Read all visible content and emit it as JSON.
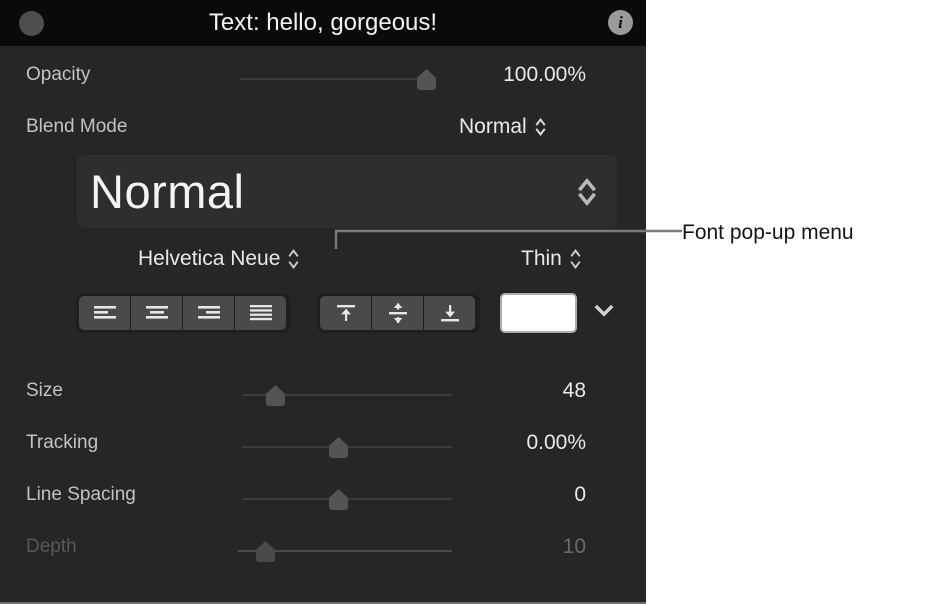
{
  "window": {
    "title": "Text: hello, gorgeous!",
    "left_circle_icon": "circle-icon",
    "info_icon": "i"
  },
  "inspector": {
    "opacity": {
      "label": "Opacity",
      "value": "100.00%",
      "slider": {
        "percent": 100
      }
    },
    "blend_mode": {
      "label": "Blend Mode",
      "value": "Normal"
    },
    "font_preview": {
      "value": "Normal",
      "chevron_icon": "chevron-up-down-icon"
    },
    "font_family": {
      "value": "Helvetica Neue",
      "chevron_icon": "chevron-up-down-icon"
    },
    "font_weight": {
      "value": "Thin",
      "chevron_icon": "chevron-up-down-icon"
    },
    "horizontal_align": {
      "options": [
        {
          "name": "align-left-icon",
          "label": "Align Left",
          "selected": false
        },
        {
          "name": "align-center-icon",
          "label": "Align Center",
          "selected": false
        },
        {
          "name": "align-right-icon",
          "label": "Align Right",
          "selected": false
        },
        {
          "name": "align-justify-icon",
          "label": "Justify",
          "selected": false
        }
      ]
    },
    "vertical_align": {
      "options": [
        {
          "name": "align-top-icon",
          "label": "Align Top",
          "selected": false
        },
        {
          "name": "align-middle-icon",
          "label": "Align Middle",
          "selected": false
        },
        {
          "name": "align-bottom-icon",
          "label": "Align Bottom",
          "selected": false
        }
      ]
    },
    "text_color": {
      "swatch_hex": "#ffffff",
      "disclosure_icon": "chevron-down-icon"
    },
    "size": {
      "label": "Size",
      "value": "48",
      "slider": {
        "percent": 16
      }
    },
    "tracking": {
      "label": "Tracking",
      "value": "0.00%",
      "slider": {
        "percent": 46
      }
    },
    "line_spacing": {
      "label": "Line Spacing",
      "value": "0",
      "slider": {
        "percent": 46
      }
    },
    "depth": {
      "label": "Depth",
      "value": "10",
      "disabled": true,
      "slider": {
        "percent": 11
      }
    }
  },
  "annotation": {
    "callout_text": "Font pop-up menu"
  },
  "colors": {
    "panel_bg": "#262626",
    "titlebar_bg": "#0a0a0a",
    "label": "#c3c3c3",
    "value": "#e9e9e9",
    "disabled": "#585858",
    "swatch": "#ffffff",
    "callout": "#151515",
    "leader_line": "#7a7a7a"
  }
}
